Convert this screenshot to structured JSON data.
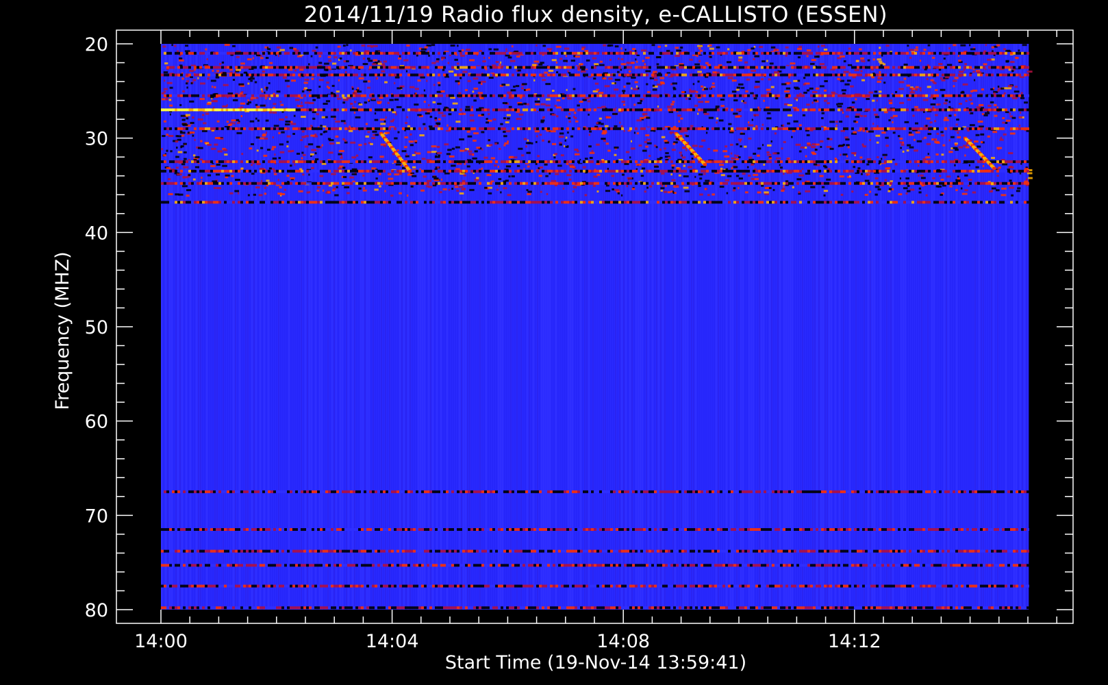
{
  "chart_data": {
    "type": "heatmap",
    "title": "2014/11/19  Radio flux density, e-CALLISTO (ESSEN)",
    "xlabel": "Start Time (19-Nov-14 13:59:41)",
    "ylabel": "Frequency (MHZ)",
    "x_ticks": [
      "14:00",
      "14:04",
      "14:08",
      "14:12"
    ],
    "y_ticks": [
      "20",
      "30",
      "40",
      "50",
      "60",
      "70",
      "80"
    ],
    "y_tick_values": [
      20,
      30,
      40,
      50,
      60,
      70,
      80
    ],
    "x_tick_minutes": [
      0,
      4,
      8,
      12
    ],
    "ylim": [
      80,
      20
    ],
    "frequency_range_mhz": [
      20,
      80
    ],
    "time_range_minutes_after_1400": [
      0,
      15
    ],
    "colormap": [
      "#000000",
      "#1a10ff",
      "#3030ff",
      "#b01040",
      "#ff3000",
      "#ffb000",
      "#ffff40"
    ],
    "background_color": "#2a2aff",
    "interference_bands_mhz": [
      21,
      22.5,
      23.3,
      25.5,
      27,
      29,
      32.5,
      33.5,
      34.8,
      36.8,
      67.5,
      71.5,
      73.8,
      75.3,
      77.5,
      79.8
    ],
    "drifting_bursts": [
      {
        "start_min": 3.8,
        "end_min": 4.3,
        "start_mhz": 29.5,
        "end_mhz": 33.5
      },
      {
        "start_min": 8.9,
        "end_min": 9.4,
        "start_mhz": 29.5,
        "end_mhz": 32.8
      },
      {
        "start_min": 13.9,
        "end_min": 14.4,
        "start_mhz": 30,
        "end_mhz": 33.2
      }
    ]
  }
}
